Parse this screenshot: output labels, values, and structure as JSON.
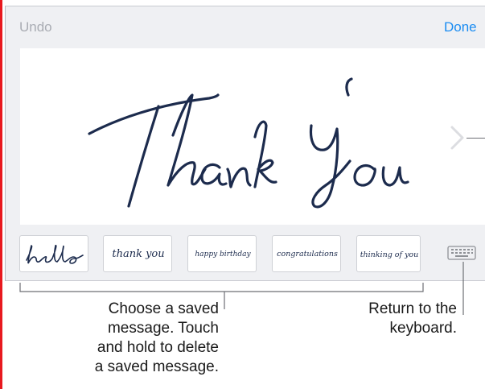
{
  "toolbar": {
    "undo_label": "Undo",
    "done_label": "Done"
  },
  "canvas": {
    "handwriting": "Thank You",
    "ink_color": "#1c2b4d",
    "next_icon": "chevron-right-icon"
  },
  "saved_messages": [
    {
      "label": "hello"
    },
    {
      "label": "thank you"
    },
    {
      "label": "happy birthday"
    },
    {
      "label": "congratulations"
    },
    {
      "label": "thinking of you"
    }
  ],
  "keyboard_button": {
    "icon": "keyboard-icon"
  },
  "callouts": {
    "saved_message_text": "Choose a saved\nmessage. Touch\nand hold to delete\na saved message.",
    "keyboard_text": "Return to the\nkeyboard."
  },
  "colors": {
    "accent": "#1a8cf2",
    "disabled": "#a9acb3",
    "panel_bg": "#eff0f3",
    "callout_line": "#6d6f74",
    "margin_marker": "#e8191f"
  }
}
